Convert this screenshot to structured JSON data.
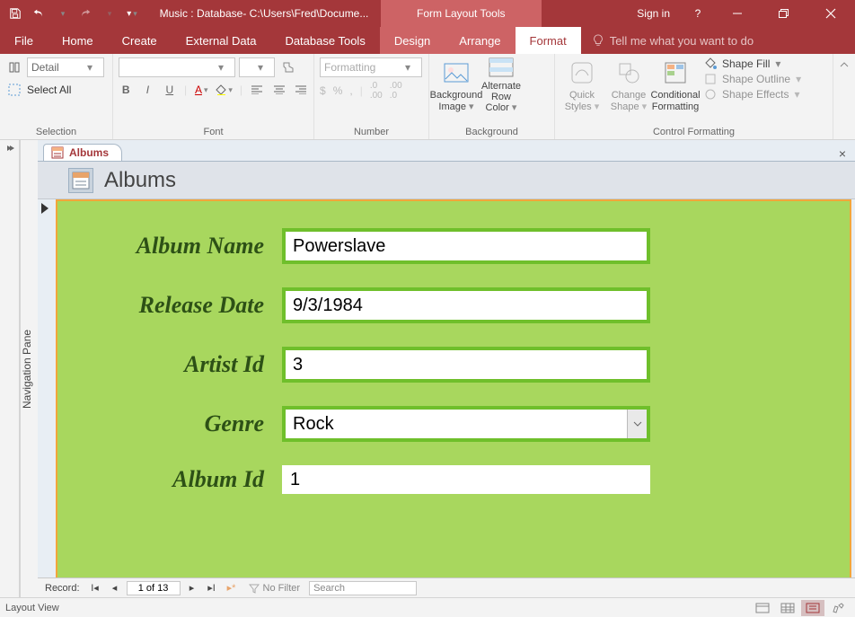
{
  "titlebar": {
    "title": "Music : Database- C:\\Users\\Fred\\Docume...",
    "tool_context": "Form Layout Tools",
    "signin": "Sign in"
  },
  "tabs": {
    "file": "File",
    "home": "Home",
    "create": "Create",
    "external": "External Data",
    "dbtools": "Database Tools",
    "design": "Design",
    "arrange": "Arrange",
    "format": "Format",
    "tellme": "Tell me what you want to do"
  },
  "ribbon": {
    "selection": {
      "object": "Detail",
      "selectall": "Select All",
      "label": "Selection"
    },
    "font": {
      "placeholder_font": "",
      "placeholder_size": "",
      "label": "Font"
    },
    "number": {
      "format_placeholder": "Formatting",
      "label": "Number"
    },
    "background": {
      "bgimage": "Background Image",
      "altrow": "Alternate Row Color",
      "label": "Background"
    },
    "controlfmt": {
      "quick": "Quick Styles",
      "change": "Change Shape",
      "cond": "Conditional Formatting",
      "shapefill": "Shape Fill",
      "shapeoutline": "Shape Outline",
      "shapeeffects": "Shape Effects",
      "label": "Control Formatting"
    }
  },
  "navpane": "Navigation Pane",
  "doctab": "Albums",
  "form": {
    "title": "Albums",
    "fields": {
      "album_name": {
        "label": "Album Name",
        "value": "Powerslave"
      },
      "release_date": {
        "label": "Release Date",
        "value": "9/3/1984"
      },
      "artist_id": {
        "label": "Artist Id",
        "value": "3"
      },
      "genre": {
        "label": "Genre",
        "value": "Rock"
      },
      "album_id": {
        "label": "Album Id",
        "value": "1"
      }
    }
  },
  "recnav": {
    "label": "Record:",
    "position": "1 of 13",
    "nofilter": "No Filter",
    "search": "Search"
  },
  "statusbar": {
    "view": "Layout View"
  }
}
